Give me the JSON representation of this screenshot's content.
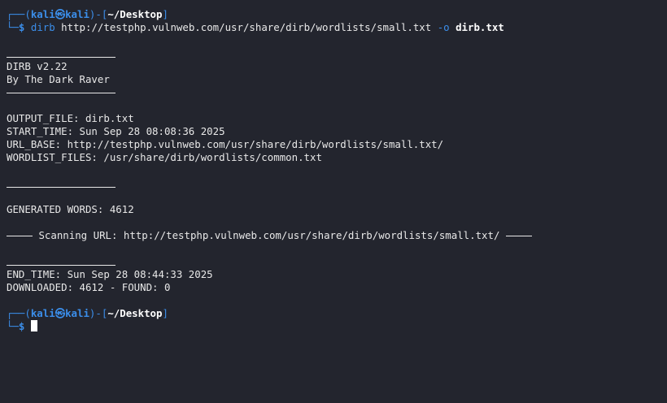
{
  "prompt1": {
    "corner_top": "┌──(",
    "user": "kali",
    "at_symbol": "㉿",
    "host": "kali",
    "mid": ")-[",
    "path": "~/Desktop",
    "end": "]",
    "corner_bottom": "└─",
    "dollar": "$",
    "command": "dirb",
    "url_arg": "http://testphp.vulnweb.com/usr/share/dirb/wordlists/small.txt",
    "option": "-o",
    "output_arg": "dirb.txt"
  },
  "output": {
    "banner_name": "DIRB v2.22",
    "banner_author": "By The Dark Raver",
    "output_file": "OUTPUT_FILE: dirb.txt",
    "start_time": "START_TIME: Sun Sep 28 08:08:36 2025",
    "url_base": "URL_BASE: http://testphp.vulnweb.com/usr/share/dirb/wordlists/small.txt/",
    "wordlist_files": "WORDLIST_FILES: /usr/share/dirb/wordlists/common.txt",
    "generated_words": "GENERATED WORDS: 4612",
    "scanning_url": "Scanning URL: http://testphp.vulnweb.com/usr/share/dirb/wordlists/small.txt/",
    "end_time": "END_TIME: Sun Sep 28 08:44:33 2025",
    "downloaded": "DOWNLOADED: 4612 - FOUND: 0"
  },
  "prompt2": {
    "corner_top": "┌──(",
    "user": "kali",
    "at_symbol": "㉿",
    "host": "kali",
    "mid": ")-[",
    "path": "~/Desktop",
    "end": "]",
    "corner_bottom": "└─",
    "dollar": "$"
  },
  "colors": {
    "background": "#23252e",
    "prompt_blue": "#3b8eea",
    "text": "#e8e8e8"
  }
}
